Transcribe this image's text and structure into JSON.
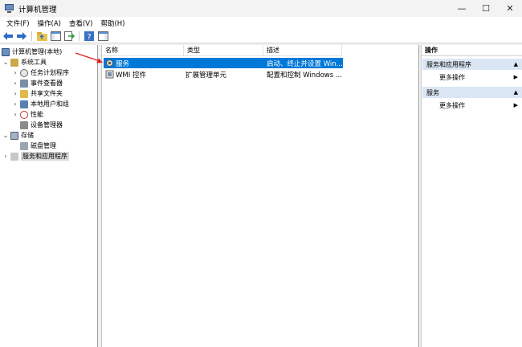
{
  "window": {
    "title": "计算机管理",
    "minimize": "—",
    "maximize": "☐",
    "close": "✕"
  },
  "menu": {
    "items": [
      "文件(F)",
      "操作(A)",
      "查看(V)",
      "帮助(H)"
    ]
  },
  "tree": {
    "root": "计算机管理(本地)",
    "system_tools": "系统工具",
    "task_scheduler": "任务计划程序",
    "event_viewer": "事件查看器",
    "shared_folders": "共享文件夹",
    "local_users": "本地用户和组",
    "performance": "性能",
    "device_manager": "设备管理器",
    "storage": "存储",
    "disk_management": "磁盘管理",
    "services_apps": "服务和应用程序",
    "expanded_glyph": "⌄",
    "collapsed_glyph": "›"
  },
  "list": {
    "columns": [
      "名称",
      "类型",
      "描述"
    ],
    "rows": [
      {
        "name": "服务",
        "type": "",
        "description": "启动、终止并设置 Win...",
        "selected": true
      },
      {
        "name": "WMI 控件",
        "type": "扩展管理单元",
        "description": "配置和控制 Windows ...",
        "selected": false
      }
    ]
  },
  "actions": {
    "title": "操作",
    "sections": [
      {
        "label": "服务和应用程序",
        "item": "更多操作"
      },
      {
        "label": "服务",
        "item": "更多操作"
      }
    ]
  },
  "colors": {
    "selection": "#0078d7",
    "action_section": "#dbe6f4",
    "annotation_arrow": "#e02020"
  }
}
